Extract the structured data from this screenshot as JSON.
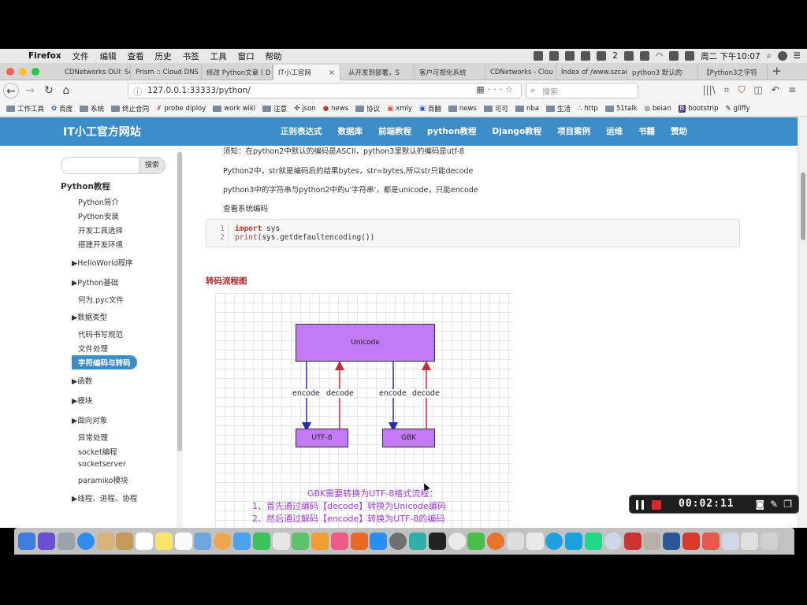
{
  "menubar": {
    "app": "Firefox",
    "items": [
      "文件",
      "编辑",
      "查看",
      "历史",
      "书签",
      "工具",
      "窗口",
      "帮助"
    ],
    "badge": "2",
    "clock": "周二 下午10:07"
  },
  "tabs": [
    {
      "label": "CDNetworks OUI: Se"
    },
    {
      "label": "Prism :: Cloud DNS"
    },
    {
      "label": "修改 Python文章 ( D"
    },
    {
      "label": "IT小工官网",
      "active": true
    },
    {
      "label": "从开发到部署，S"
    },
    {
      "label": "客户可视化系统"
    },
    {
      "label": "CDNetworks - Clou"
    },
    {
      "label": "Index of /www.szcar"
    },
    {
      "label": "python3 默认的"
    },
    {
      "label": "【Python3之字符"
    }
  ],
  "navbar": {
    "url": "127.0.0.1:33333/python/",
    "search_placeholder": "搜索"
  },
  "bookmarks": [
    "工作工具",
    "百度",
    "系统",
    "终止合同",
    "probe diploy",
    "work wiki",
    "注意",
    "json",
    "news",
    "协议",
    "xmly",
    "百翻",
    "news",
    "可可",
    "nba",
    "生活",
    "http",
    "51talk",
    "beian",
    "bootstrip",
    "gliffy"
  ],
  "site": {
    "title": "IT小工官方网站",
    "nav": [
      "正则表达式",
      "数据库",
      "前端教程",
      "python教程",
      "Django教程",
      "项目案例",
      "运维",
      "书籍",
      "赞助"
    ]
  },
  "sidebar": {
    "search_button": "搜索",
    "heading": "Python教程",
    "items": [
      {
        "label": "Python简介"
      },
      {
        "label": "Python安装"
      },
      {
        "label": "开发工具选择"
      },
      {
        "label": "搭建开发环境"
      },
      {
        "label": "▶HelloWorld程序"
      },
      {
        "label": "▶Python基础"
      },
      {
        "label": "何为.pyc文件"
      },
      {
        "label": "▶数据类型"
      },
      {
        "label": "代码书写规范"
      },
      {
        "label": "文件处理"
      },
      {
        "label": "字符编码与转码",
        "active": true
      },
      {
        "label": "▶函数"
      },
      {
        "label": "▶模块"
      },
      {
        "label": "▶面向对象"
      },
      {
        "label": "异常处理"
      },
      {
        "label": "socket编程"
      },
      {
        "label": "socketserver"
      },
      {
        "label": "paramiko模块"
      },
      {
        "label": "▶线程、进程、协程"
      }
    ]
  },
  "content": {
    "paragraphs": [
      "须知：在python2中默认的编码是ASCII，python3里默认的编码是utf-8",
      "Python2中，str就是编码后的结果bytes，str=bytes,所以str只能decode",
      "python3中的字符串与python2中的u'字符串'，都是unicode，只能encode",
      "查看系统编码"
    ],
    "code": {
      "line_numbers": [
        "1",
        "2"
      ],
      "line1_kw": "import",
      "line1_rest": " sys",
      "line2_fn": "print",
      "line2_rest": "(sys.getdefaultencoding())"
    },
    "section_title": "转码流程图",
    "diagram": {
      "top_box": "Unicode",
      "left_box": "UTF-8",
      "right_box": "GBK",
      "labels": [
        "encode",
        "decode",
        "encode",
        "decode"
      ],
      "caption": [
        "GBK需要转换为UTF-8格式流程：",
        "1、首先通过编码【decode】转换为Unicode编码",
        "2、然后通过解码【encode】转换为UTF-8的编码"
      ]
    }
  },
  "recorder": {
    "time": "00:02:11"
  },
  "colors": {
    "site_blue": "#3b8cc7",
    "box_purple": "#c27bf5",
    "section_red": "#b0232a"
  }
}
